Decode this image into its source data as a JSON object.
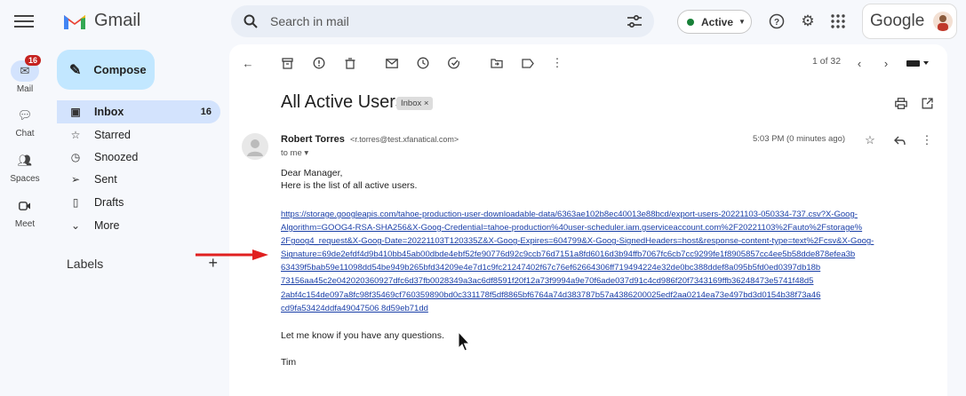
{
  "app": {
    "name": "Gmail"
  },
  "search": {
    "placeholder": "Search in mail"
  },
  "status": {
    "label": "Active"
  },
  "account": {
    "brand": "Google"
  },
  "rail": [
    {
      "label": "Mail",
      "icon": "mail-icon",
      "badge": "16"
    },
    {
      "label": "Chat",
      "icon": "chat-icon"
    },
    {
      "label": "Spaces",
      "icon": "spaces-icon"
    },
    {
      "label": "Meet",
      "icon": "meet-icon"
    }
  ],
  "compose": {
    "label": "Compose"
  },
  "nav": [
    {
      "label": "Inbox",
      "icon": "inbox-icon",
      "count": "16"
    },
    {
      "label": "Starred",
      "icon": "star-icon"
    },
    {
      "label": "Snoozed",
      "icon": "clock-icon"
    },
    {
      "label": "Sent",
      "icon": "send-icon"
    },
    {
      "label": "Drafts",
      "icon": "draft-icon"
    },
    {
      "label": "More",
      "icon": "chevron-down-icon"
    }
  ],
  "labels": {
    "title": "Labels",
    "add": "+"
  },
  "pager": {
    "text": "1 of 32"
  },
  "email": {
    "subject": "All Active Users",
    "label_chip": "Inbox ×",
    "sender_name": "Robert Torres",
    "sender_email": "<r.torres@test.xfanatical.com>",
    "to": "to me ▾",
    "time": "5:03 PM (0 minutes ago)",
    "greeting": "Dear Manager,",
    "intro": "Here is the list of all active users.",
    "link_lines": [
      "https://storage.googleapis.com/tahoe-production-user-downloadable-data/6363ae102b8ec40013e88bcd/export-users-20221103-050334-737.csv?X-Goog-",
      "Algorithm=GOOG4-RSA-SHA256&X-Goog-Credential=tahoe-production%40user-scheduler.iam.gserviceaccount.com%2F20221103%2Fauto%2Fstorage%",
      "2Fgoog4_request&X-Goog-Date=20221103T120335Z&X-Goog-Expires=604799&X-Goog-SignedHeaders=host&response-content-type=text%2Fcsv&X-Goog-",
      "Signature=69de2efdf4d9b410bb45ab00dbde4ebf52fe90776d92c9ccb76d7151a8fd6016d3b94ffb7067fc6cb7cc9299fe1f8905857cc4ee5b58dde878efea3b",
      "63439f5bab59e11098dd54be949b265bfd34209e4e7d1c9fc21247402f67c76ef62664306ff719494224e32de0bc388ddef8a095b5fd0ed0397db18b",
      "73156aa45c2e042020360927dfc6d37fb0028349a3ac6df8591f20f12a73f9994a9e70f6ade037d91c4cd986f20f7343169ffb36248473e5741f48d5",
      "2abf4c154de097a8fc98f35469cf760359890bd0c331178f5df8865bf6764a74d383787b57a4386200025edf2aa0214ea73e497bd3d0154b38f73a46",
      "cd9fa53424ddfa49047506 8d59eb71dd"
    ],
    "closing": "Let me know if you have any questions.",
    "signature": "Tim"
  }
}
